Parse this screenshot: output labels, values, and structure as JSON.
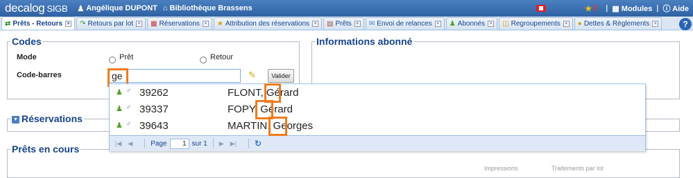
{
  "header": {
    "logo": "decalog",
    "logo_suffix": "SIGB",
    "user": "Angélique DUPONT",
    "library": "Bibliothèque Brassens",
    "alert_count": "2",
    "modules_label": "Modules",
    "help_label": "Aide"
  },
  "tabs": [
    {
      "label": "Prêts - Retours",
      "icon": "loan-return-icon",
      "active": true
    },
    {
      "label": "Retours par lot",
      "icon": "batch-return-icon"
    },
    {
      "label": "Réservations",
      "icon": "calendar-icon"
    },
    {
      "label": "Attribution des réservations",
      "icon": "assign-icon"
    },
    {
      "label": "Prêts",
      "icon": "books-icon"
    },
    {
      "label": "Envoi de relances",
      "icon": "mail-icon"
    },
    {
      "label": "Abonnés",
      "icon": "users-icon"
    },
    {
      "label": "Regroupements",
      "icon": "folder-icon"
    },
    {
      "label": "Dettes & Règlements",
      "icon": "money-icon"
    }
  ],
  "codes": {
    "title": "Codes",
    "mode_label": "Mode",
    "mode_options": [
      "Prêt",
      "Retour"
    ],
    "barcode_label": "Code-barres",
    "barcode_value": "ge",
    "validate_label": "Valider"
  },
  "info": {
    "title": "Informations abonné"
  },
  "reservations": {
    "title": "Réservations"
  },
  "prets": {
    "title": "Prêts en cours",
    "impressions_label": "Impressions",
    "traitements_label": "Traitements par lot"
  },
  "suggestions": [
    {
      "number": "39262",
      "name": "FLONT, Gérard"
    },
    {
      "number": "39337",
      "name": "FOPY, Gérard"
    },
    {
      "number": "39643",
      "name": "MARTIN, Georges"
    }
  ],
  "pager": {
    "page_label": "Page",
    "page_value": "1",
    "of_label": "sur 1"
  },
  "colors": {
    "highlight": "#f07b1d",
    "header": "#2f62a3",
    "legend": "#15428b"
  }
}
